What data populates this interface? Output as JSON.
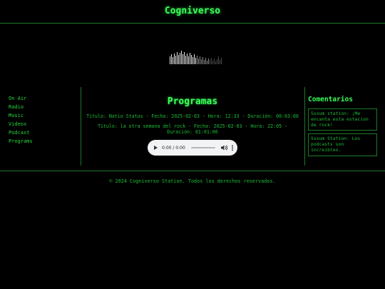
{
  "header": {
    "title": "Cogniverso"
  },
  "nav": {
    "items": [
      "On Air",
      "Radio",
      "Music",
      "Videos",
      "Podcast",
      "Programs"
    ]
  },
  "main": {
    "section_title": "Programas",
    "programs": [
      {
        "text": "Titulo: Natio Status - Fecha: 2025-02-03 - Hora: 12:33 - Duración: 00:03:00"
      },
      {
        "text": "Titulo: la otra semana del rock - Fecha: 2025-02-03 - Hora: 22:05 - Duración: 01:01:06"
      }
    ],
    "player": {
      "time": "0:00 / 0:00"
    }
  },
  "comments": {
    "title": "Comentarios",
    "items": [
      {
        "text": "Sxxum station: ¡Me encanta esta estacion de rock!"
      },
      {
        "text": "Sxxum Station: Los podcasts son increibles."
      }
    ]
  },
  "footer": {
    "copyright": "© 2024 Cogniverso Station. Todos los derechos reservados."
  },
  "colors": {
    "accent": "#39ff5a",
    "text": "#1fbd37",
    "border": "#1c7a2a",
    "background": "#000000"
  }
}
